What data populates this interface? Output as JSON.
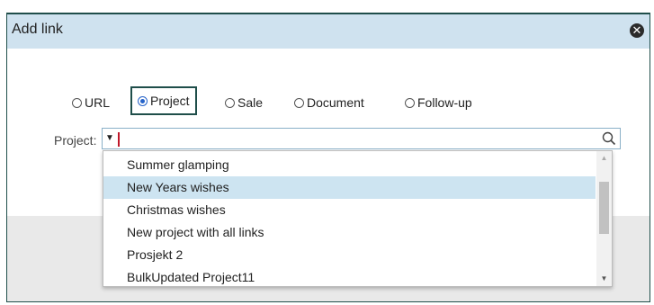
{
  "dialog": {
    "title": "Add link"
  },
  "link_types": [
    {
      "label": "URL",
      "selected": false
    },
    {
      "label": "Project",
      "selected": true
    },
    {
      "label": "Sale",
      "selected": false
    },
    {
      "label": "Document",
      "selected": false
    },
    {
      "label": "Follow-up",
      "selected": false
    }
  ],
  "project_field": {
    "label": "Project:",
    "value": ""
  },
  "dropdown": {
    "items": [
      "Summer glamping",
      "New Years wishes",
      "Christmas wishes",
      "New project with all links",
      "Prosjekt 2",
      "BulkUpdated Project11"
    ],
    "highlighted_index": 1
  },
  "colors": {
    "titlebar": "#cfe2ef",
    "accent": "#1f4e4a",
    "highlight": "#cde4f1",
    "caret": "#c0182a",
    "radio": "#2563c9"
  },
  "icons": {
    "close": "close-circle-icon",
    "search": "search-icon",
    "dropdown": "chevron-down-icon"
  }
}
